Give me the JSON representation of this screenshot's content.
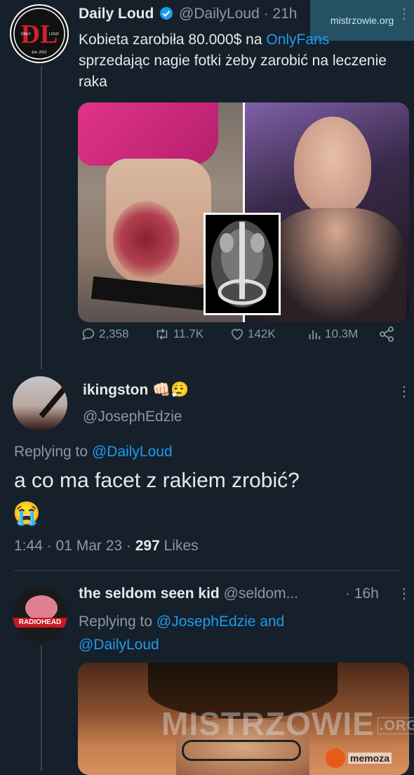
{
  "tweet1": {
    "author_name": "Daily Loud",
    "handle": "@DailyLoud",
    "time": "· 21h",
    "logo_text": "DL",
    "logo_small_left": "DAILY",
    "logo_small_right": "LOUD",
    "logo_est": "Est. 2012",
    "text_before": "Kobieta zarobiła 80.000$ na ",
    "text_link": "OnlyFans",
    "text_after": " sprzedając nagie fotki żeby zarobić na leczenie raka",
    "stats": {
      "replies": "2,358",
      "retweets": "11.7K",
      "likes": "142K",
      "views": "10.3M"
    }
  },
  "tweet2": {
    "author_name": "ikingston",
    "emoji": "👊🏻😮‍💨",
    "handle": "@JosephEdzie",
    "replying_prefix": "Replying to ",
    "replying_to": "@DailyLoud",
    "text": "a co ma facet z rakiem zrobić?",
    "emoji_line": "😭",
    "time": "1:44 · 01 Mar 23 · ",
    "likes_count": "297",
    "likes_label": " Likes"
  },
  "tweet3": {
    "author_name": "the seldom seen kid",
    "handle": "@seldom...",
    "time": "· 16h",
    "avatar_text": "RADIOHEAD",
    "replying_prefix": "Replying to ",
    "replying_to_1": "@JosephEdzie",
    "replying_and": " and",
    "replying_to_2": "@DailyLoud"
  },
  "watermarks": {
    "top": "mistrzowie.org",
    "bottom": "MISTRZOWIE",
    "bottom_org": ".ORG",
    "memoza": "memoza"
  },
  "colors": {
    "background": "#15202b",
    "accent": "#1d9bf0",
    "muted": "#8b98a5"
  }
}
